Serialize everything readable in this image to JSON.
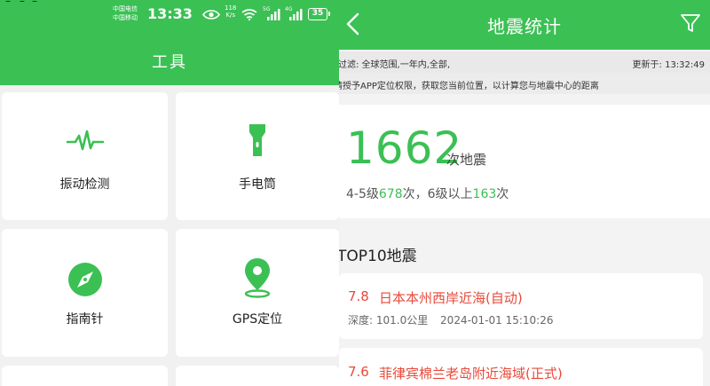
{
  "left": {
    "status": {
      "carrier_1": "中国电信",
      "carrier_2": "中国移动",
      "time": "13:33",
      "speed_value": "118",
      "speed_unit": "K/s",
      "battery": "35",
      "signal_1": "5G",
      "signal_2": "4G"
    },
    "title": "工具",
    "tools": [
      {
        "label": "振动检测",
        "icon": "pulse-icon"
      },
      {
        "label": "手电筒",
        "icon": "flashlight-icon"
      },
      {
        "label": "指南针",
        "icon": "compass-icon"
      },
      {
        "label": "GPS定位",
        "icon": "location-pin-icon"
      }
    ]
  },
  "right": {
    "title": "地震统计",
    "filter_text": "过滤: 全球范围,一年内,全部,",
    "updated_text": "更新于: 13:32:49",
    "location_hint": "请授予APP定位权限，获取您当前位置，以计算您与地震中心的距离",
    "total_count": "1662",
    "total_unit": "次地震",
    "breakdown": {
      "prefix": "4-5级",
      "count_a": "678",
      "mid": "次，6级以上",
      "count_b": "163",
      "suffix": "次"
    },
    "top10_label": "TOP10地震",
    "quakes": [
      {
        "magnitude": "7.8",
        "place": "日本本州西岸近海(自动)",
        "depth": "深度: 101.0公里",
        "time": "2024-01-01 15:10:26"
      },
      {
        "magnitude": "7.6",
        "place": "菲律宾棉兰老岛附近海域(正式)",
        "depth": "",
        "time": ""
      }
    ]
  },
  "colors": {
    "brand_green": "#3bc054",
    "quake_red": "#e84a3a"
  }
}
